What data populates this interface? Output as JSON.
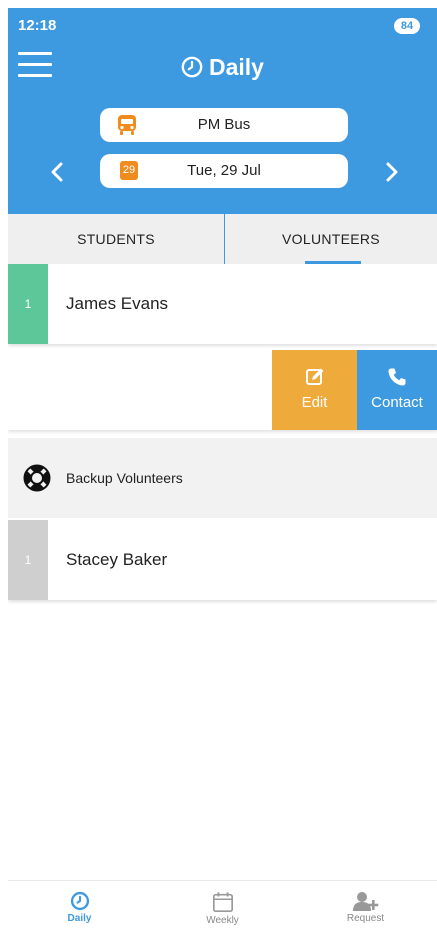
{
  "status_bar": {
    "time": "12:18",
    "battery": "84"
  },
  "header": {
    "title": "Daily"
  },
  "bus": {
    "label": "PM Bus"
  },
  "date": {
    "badge": "29",
    "label": "Tue, 29 Jul"
  },
  "tabs": [
    {
      "label": "STUDENTS"
    },
    {
      "label": "VOLUNTEERS",
      "active": true
    }
  ],
  "volunteers": [
    {
      "number": "1",
      "name": "James Evans"
    }
  ],
  "swipe_actions": {
    "edit": "Edit",
    "contact": "Contact"
  },
  "backup": {
    "heading": "Backup Volunteers",
    "items": [
      {
        "number": "1",
        "name": "Stacey Baker"
      }
    ]
  },
  "bottom_nav": [
    {
      "label": "Daily"
    },
    {
      "label": "Weekly"
    },
    {
      "label": "Request"
    }
  ],
  "colors": {
    "primary": "#3d9ae0",
    "accent_orange": "#f08c1e",
    "edit": "#eeaa3a",
    "green": "#5ec79a",
    "grey": "#cfcfcf"
  },
  "icons": {
    "menu": "hamburger-icon",
    "title": "clock-icon",
    "bus": "bus-icon",
    "date": "calendar-badge-icon",
    "prev": "chevron-left-icon",
    "next": "chevron-right-icon",
    "edit": "edit-icon",
    "contact": "phone-icon",
    "backup": "lifebuoy-icon",
    "daily": "clock-icon",
    "weekly": "calendar-icon",
    "request": "add-user-icon"
  }
}
